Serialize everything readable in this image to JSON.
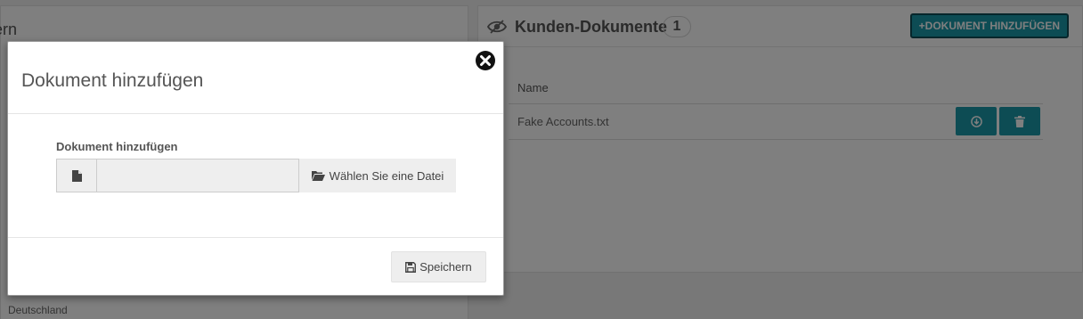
{
  "background": {
    "left_panel": {
      "title_fragment": "ern",
      "country": "Deutschland"
    },
    "documents_panel": {
      "title": "Kunden-Dokumente",
      "count": "1",
      "add_button_label": "DOKUMENT HINZUFÜGEN",
      "table": {
        "columns": [
          "Name"
        ],
        "rows": [
          {
            "name": "Fake Accounts.txt"
          }
        ]
      }
    }
  },
  "modal": {
    "title": "Dokument hinzufügen",
    "field_label": "Dokument hinzufügen",
    "file_input_value": "",
    "choose_file_label": "Wählen Sie eine Datei",
    "save_label": "Speichern"
  },
  "colors": {
    "accent": "#1a98a8",
    "overlay": "rgba(0,0,0,0.5)"
  },
  "icons": {
    "header": "eye-slash-icon",
    "add": "plus-icon",
    "download": "circle-arrow-down-icon",
    "delete": "trash-icon",
    "close": "close-circle-icon",
    "file": "file-icon",
    "folder": "folder-open-icon",
    "save": "floppy-disk-icon"
  }
}
